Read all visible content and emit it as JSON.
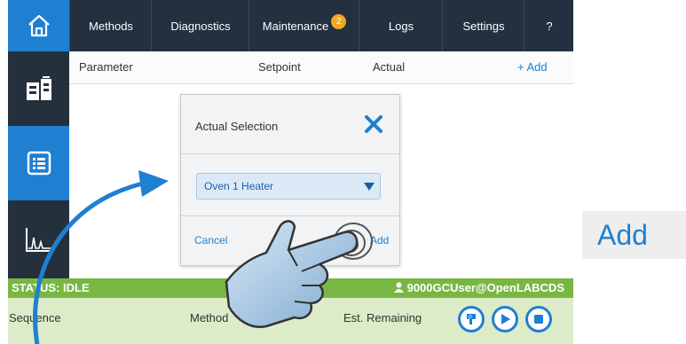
{
  "nav": {
    "items": [
      {
        "label": "Methods"
      },
      {
        "label": "Diagnostics"
      },
      {
        "label": "Maintenance"
      },
      {
        "label": "Logs"
      },
      {
        "label": "Settings"
      },
      {
        "label": "?"
      }
    ],
    "maintenance_badge": "2"
  },
  "sidebar": {
    "items": [
      {
        "icon": "instrument-icon"
      },
      {
        "icon": "list-icon"
      },
      {
        "icon": "chromatogram-icon"
      }
    ]
  },
  "table": {
    "headers": {
      "parameter": "Parameter",
      "setpoint": "Setpoint",
      "actual": "Actual",
      "add": "+ Add"
    }
  },
  "dialog": {
    "title": "Actual Selection",
    "selected": "Oven 1 Heater",
    "cancel": "Cancel",
    "add": "Add"
  },
  "status": {
    "text": "STATUS: IDLE",
    "user": "9000GCUser@OpenLABCDS"
  },
  "footer": {
    "sequence": "Sequence",
    "method": "Method",
    "remaining": "Est. Remaining"
  },
  "callout": {
    "label": "Add"
  },
  "colors": {
    "accent": "#1f7fd1",
    "status_green": "#78b743",
    "nav_bg": "#223040",
    "badge": "#f2a623"
  }
}
